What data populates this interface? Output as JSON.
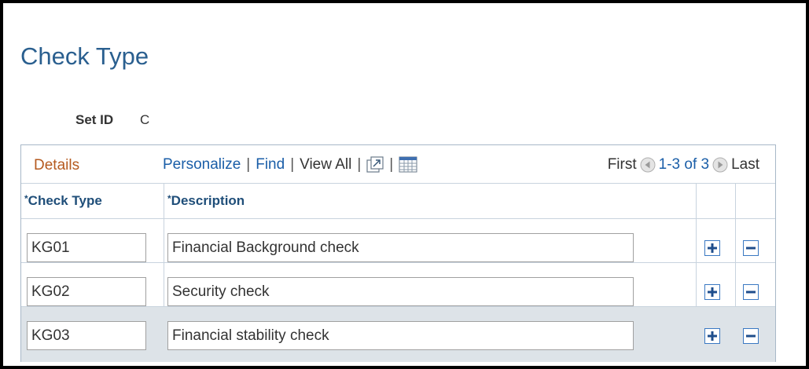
{
  "page": {
    "title": "Check Type"
  },
  "setid": {
    "label": "Set ID",
    "value": "C"
  },
  "grid": {
    "nav": {
      "details": "Details",
      "personalize": "Personalize",
      "find": "Find",
      "view_all": "View All",
      "separator": "|",
      "first": "First",
      "range": "1-3 of 3",
      "last": "Last"
    },
    "columns": {
      "check_type": "Check Type",
      "description": "Description",
      "required_mark": "*"
    },
    "rows": [
      {
        "check_type": "KG01",
        "description": "Financial Background check"
      },
      {
        "check_type": "KG02",
        "description": "Security check"
      },
      {
        "check_type": "KG03",
        "description": "Financial stability check"
      }
    ]
  },
  "colors": {
    "title": "#2a5f8f",
    "link": "#1a5ea8",
    "details": "#b55a1f",
    "header_text": "#1f4e79",
    "selected_row": "#dde3e8"
  },
  "icons": [
    "zoom-icon",
    "download-icon",
    "prev-arrow-icon",
    "next-arrow-icon",
    "add-row-icon",
    "delete-row-icon"
  ]
}
